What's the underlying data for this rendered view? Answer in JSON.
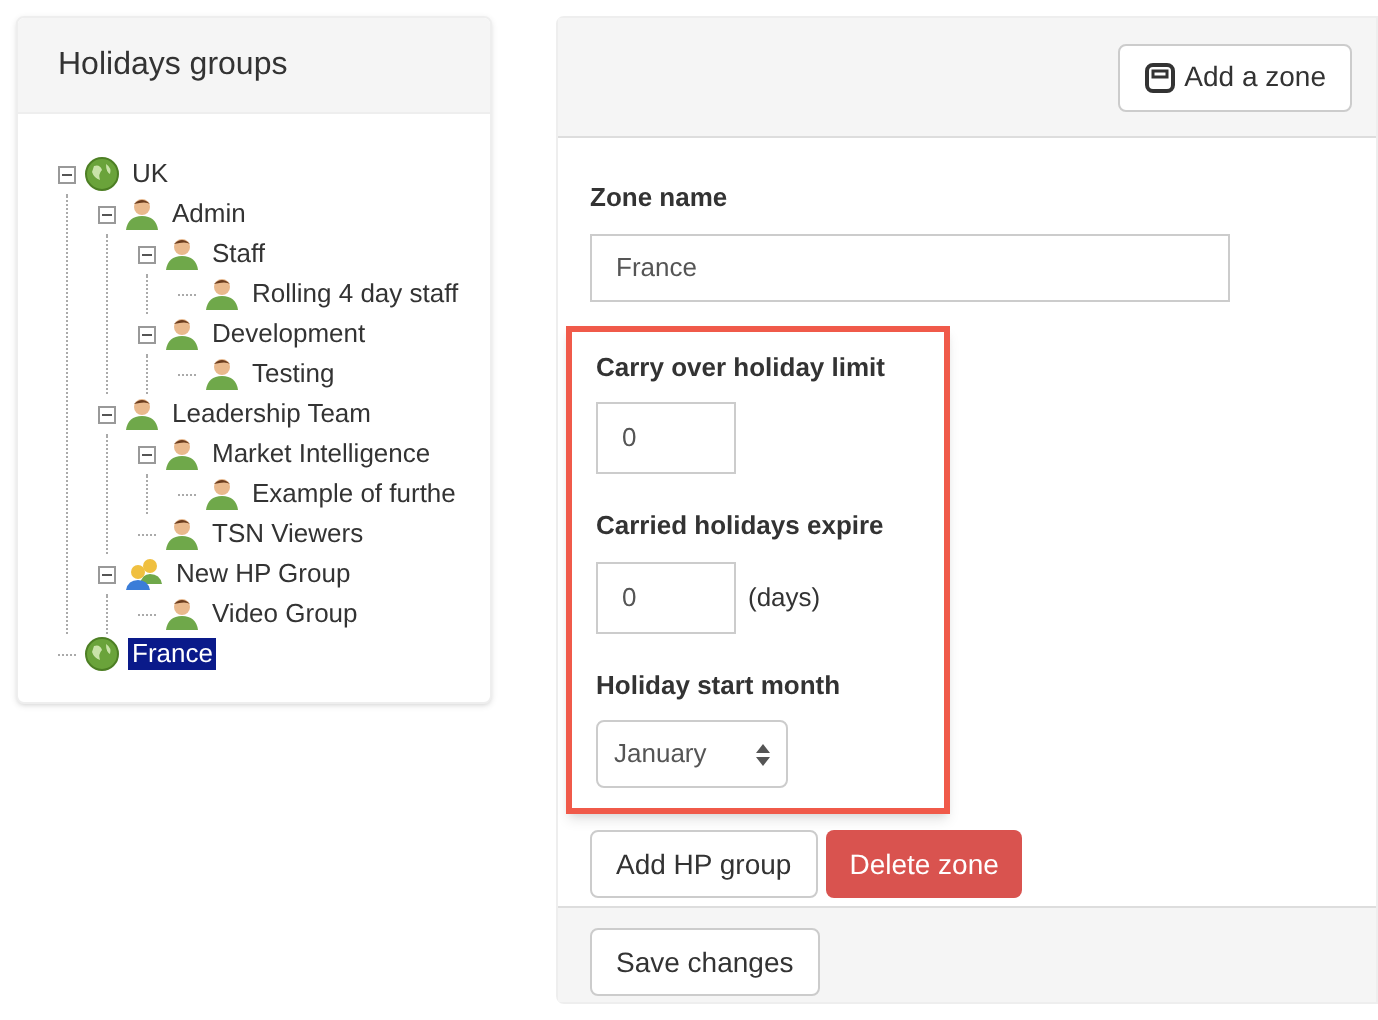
{
  "groups_panel": {
    "title": "Holidays groups",
    "tree": [
      {
        "label": "UK",
        "kind": "globe",
        "expanded": true,
        "selected": false,
        "children": [
          {
            "label": "Admin",
            "kind": "person",
            "expanded": true,
            "selected": false,
            "children": [
              {
                "label": "Staff",
                "kind": "person",
                "expanded": true,
                "selected": false,
                "children": [
                  {
                    "label": "Rolling 4 day staff",
                    "kind": "person",
                    "selected": false
                  }
                ]
              },
              {
                "label": "Development",
                "kind": "person",
                "expanded": true,
                "selected": false,
                "children": [
                  {
                    "label": "Testing",
                    "kind": "person",
                    "selected": false
                  }
                ]
              }
            ]
          },
          {
            "label": "Leadership Team",
            "kind": "person",
            "expanded": true,
            "selected": false,
            "children": [
              {
                "label": "Market Intelligence",
                "kind": "person",
                "expanded": true,
                "selected": false,
                "children": [
                  {
                    "label": "Example of furthe",
                    "kind": "person",
                    "selected": false
                  }
                ]
              },
              {
                "label": "TSN Viewers",
                "kind": "person",
                "selected": false
              }
            ]
          },
          {
            "label": "New HP Group",
            "kind": "group",
            "expanded": true,
            "selected": false,
            "children": [
              {
                "label": "Video Group",
                "kind": "person",
                "selected": false
              }
            ]
          }
        ]
      },
      {
        "label": "France",
        "kind": "globe",
        "selected": true
      }
    ]
  },
  "zone_panel": {
    "add_zone_button": "Add a zone",
    "zone_name": {
      "label": "Zone name",
      "value": "France"
    },
    "carry_over_limit": {
      "label": "Carry over holiday limit",
      "value": "0"
    },
    "carried_expire": {
      "label": "Carried holidays expire",
      "value": "0",
      "unit": "(days)"
    },
    "start_month": {
      "label": "Holiday start month",
      "value": "January"
    },
    "add_hp_group_button": "Add HP group",
    "delete_zone_button": "Delete zone",
    "save_button": "Save changes"
  }
}
